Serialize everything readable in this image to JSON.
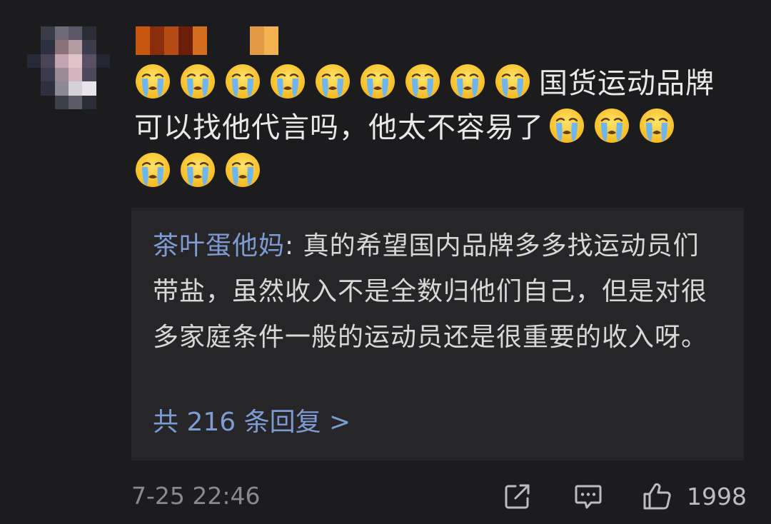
{
  "comment": {
    "text_line1_suffix": "国货运动品牌",
    "text_line2": "可以找他代言吗，他太不容易了",
    "leading_emoji_count": 9,
    "inline_emoji_count": 3,
    "trailing_emoji_count": 3,
    "emoji_name": "crying-face-icon"
  },
  "reply": {
    "author": "茶叶蛋他妈",
    "colon": ": ",
    "text": "真的希望国内品牌多多找运动员们带盐，虽然收入不是全数归他们自己，但是对很多家庭条件一般的运动员还是很重要的收入呀。",
    "more_label": "共 216 条回复 >"
  },
  "footer": {
    "timestamp": "7-25 22:46",
    "like_count": "1998"
  },
  "icons": {
    "share": "share-icon",
    "reply": "comment-icon",
    "like": "thumbs-up-icon"
  },
  "colors": {
    "background": "#1c1c1e",
    "reply_background": "#262628",
    "link": "#7f9bd3"
  }
}
